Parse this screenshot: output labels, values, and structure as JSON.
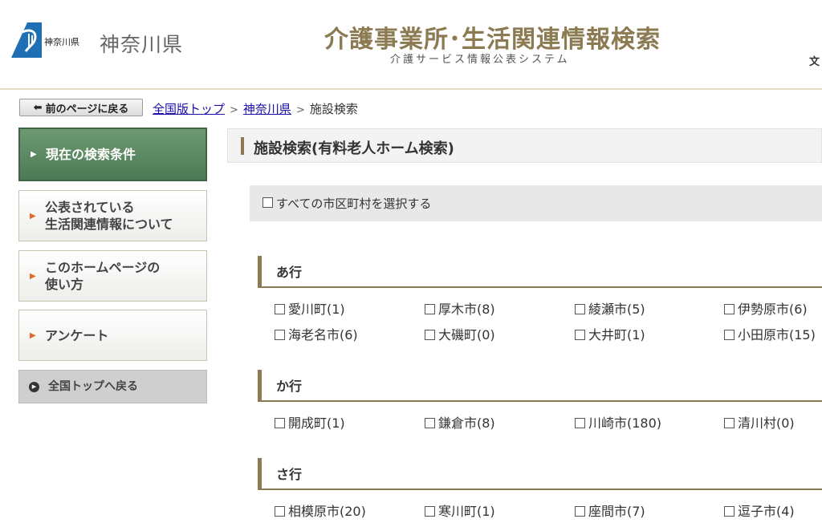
{
  "header": {
    "logo_small_text": "神奈川県",
    "prefecture": "神奈川県",
    "title": "介護事業所･生活関連情報検索",
    "subtitle": "介護サービス情報公表システム",
    "text_size_label": "文"
  },
  "breadcrumb": {
    "back_label": "前のページに戻る",
    "items": [
      "全国版トップ",
      "神奈川県",
      "施設検索"
    ],
    "separator": ">"
  },
  "sidebar": {
    "items": [
      {
        "label": "現在の検索条件"
      },
      {
        "label1": "公表されている",
        "label2": "生活関連情報について"
      },
      {
        "label1": "このホームページの",
        "label2": "使い方"
      },
      {
        "label": "アンケート"
      },
      {
        "label": "全国トップへ戻る"
      }
    ]
  },
  "main": {
    "title": "施設検索(有料老人ホーム検索)",
    "select_all": "すべての市区町村を選択する",
    "sections": [
      {
        "label": "あ行",
        "cities": [
          "愛川町(1)",
          "厚木市(8)",
          "綾瀬市(5)",
          "伊勢原市(6)",
          "海老名市(6)",
          "大磯町(0)",
          "大井町(1)",
          "小田原市(15)"
        ]
      },
      {
        "label": "か行",
        "cities": [
          "開成町(1)",
          "鎌倉市(8)",
          "川崎市(180)",
          "清川村(0)"
        ]
      },
      {
        "label": "さ行",
        "cities": [
          "相模原市(20)",
          "寒川町(1)",
          "座間市(7)",
          "逗子市(4)"
        ]
      }
    ]
  },
  "colors": {
    "accent_brown": "#8b7a52",
    "active_green": "#5a8862",
    "link": "#1a0dab",
    "arrow_orange": "#e06b2a"
  }
}
